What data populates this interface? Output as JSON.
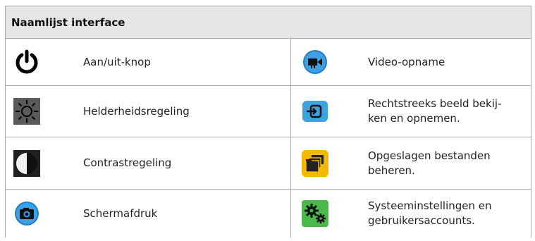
{
  "header": {
    "title": "Naamlijst interface"
  },
  "rows": [
    {
      "left": {
        "icon": "power-icon",
        "label": "Aan/uit-knop"
      },
      "right": {
        "icon": "video-camera-icon",
        "label": "Video-opname",
        "color": "#2a8fd6"
      }
    },
    {
      "left": {
        "icon": "brightness-icon",
        "label": "Helderheidsregeling"
      },
      "right": {
        "icon": "input-arrow-icon",
        "label": "Rechtstreeks beeld bekij-ken en opnemen.",
        "label_line1": "Rechtstreeks beeld bekij-",
        "label_line2": "ken en opnemen.",
        "color": "#3aa3e0"
      }
    },
    {
      "left": {
        "icon": "contrast-icon",
        "label": "Contrastregeling"
      },
      "right": {
        "icon": "folders-icon",
        "label_line1": "Opgeslagen bestanden",
        "label_line2": "beheren.",
        "color": "#f5b800"
      }
    },
    {
      "left": {
        "icon": "camera-icon",
        "label": "Schermafdruk",
        "color": "#2a8fd6"
      },
      "right": {
        "icon": "gears-icon",
        "label_line1": "Systeeminstellingen en",
        "label_line2": "gebruikersaccounts.",
        "color": "#49b94a"
      }
    }
  ]
}
